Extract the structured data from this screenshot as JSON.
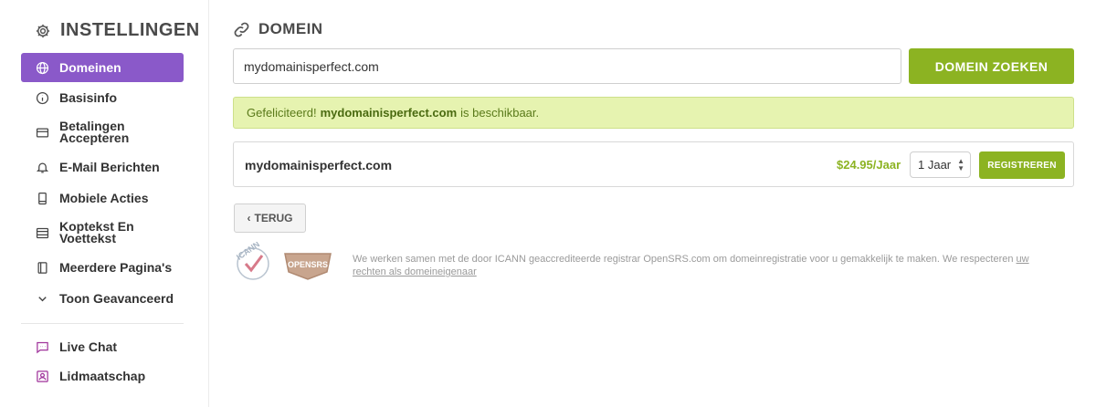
{
  "sidebar": {
    "title": "INSTELLINGEN",
    "items": [
      {
        "label": "Domeinen",
        "icon": "globe-icon",
        "active": true
      },
      {
        "label": "Basisinfo",
        "icon": "info-icon"
      },
      {
        "label": "Betalingen Accepteren",
        "icon": "credit-card-icon"
      },
      {
        "label": "E-Mail Berichten",
        "icon": "bell-icon"
      },
      {
        "label": "Mobiele Acties",
        "icon": "mobile-icon"
      },
      {
        "label": "Koptekst En Voettekst",
        "icon": "layout-icon"
      },
      {
        "label": "Meerdere Pagina's",
        "icon": "pages-icon"
      },
      {
        "label": "Toon Geavanceerd",
        "icon": "chevron-down-icon"
      }
    ],
    "extra_items": [
      {
        "label": "Live Chat",
        "icon": "chat-icon"
      },
      {
        "label": "Lidmaatschap",
        "icon": "member-icon"
      }
    ]
  },
  "main": {
    "title": "DOMEIN",
    "search": {
      "value": "mydomainisperfect.com",
      "button_label": "DOMEIN ZOEKEN"
    },
    "alert": {
      "prefix": "Gefeliciteerd!",
      "domain": "mydomainisperfect.com",
      "suffix": "is beschikbaar."
    },
    "result": {
      "domain": "mydomainisperfect.com",
      "price": "$24.95/Jaar",
      "period": "1 Jaar",
      "register_label": "REGISTREREN"
    },
    "back_label": "TERUG",
    "footnote": {
      "text": "We werken samen met de door ICANN geaccrediteerde registrar OpenSRS.com om domeinregistratie voor u gemakkelijk te maken. We respecteren",
      "link": "uw rechten als domeineigenaar"
    },
    "logos": {
      "icann": "ICANN",
      "opensrs": "OPENSRS"
    }
  },
  "colors": {
    "accent_purple": "#8a59c9",
    "accent_green": "#8cb322",
    "alert_bg": "#e6f3b0"
  }
}
